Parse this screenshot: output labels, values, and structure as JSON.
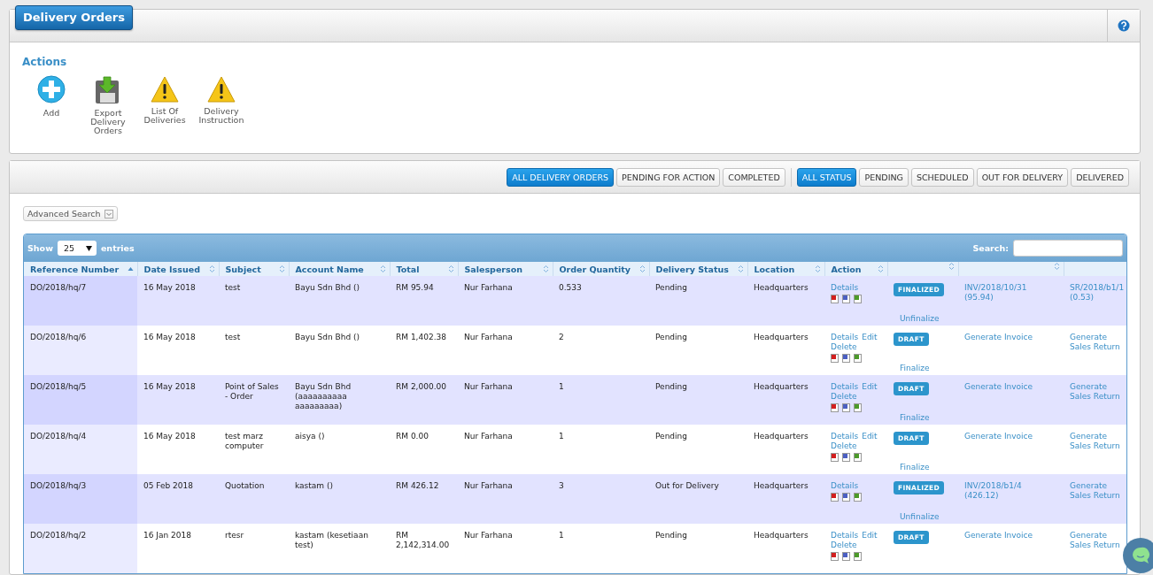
{
  "page_title": "Delivery Orders",
  "actions": {
    "heading": "Actions",
    "items": [
      {
        "kind": "add",
        "label": "Add"
      },
      {
        "kind": "export",
        "label": "Export Delivery Orders"
      },
      {
        "kind": "warning",
        "label": "List Of Deliveries"
      },
      {
        "kind": "warning",
        "label": "Delivery Instruction"
      }
    ]
  },
  "filter_groups": [
    [
      {
        "label": "ALL DELIVERY ORDERS",
        "selected": true
      },
      {
        "label": "PENDING FOR ACTION",
        "selected": false
      },
      {
        "label": "COMPLETED",
        "selected": false
      }
    ],
    [
      {
        "label": "ALL STATUS",
        "selected": true
      },
      {
        "label": "PENDING",
        "selected": false
      },
      {
        "label": "SCHEDULED",
        "selected": false
      },
      {
        "label": "OUT FOR DELIVERY",
        "selected": false
      },
      {
        "label": "DELIVERED",
        "selected": false
      }
    ]
  ],
  "advanced_search": "Advanced Search",
  "table": {
    "show_label": "Show",
    "page_size": "25",
    "entries_label": "entries",
    "search_label": "Search:",
    "columns": [
      {
        "label": "Reference Number",
        "sortable": true,
        "sorted_ascending": true
      },
      {
        "label": "Date Issued",
        "sortable": true,
        "sorted_ascending": false
      },
      {
        "label": "Subject",
        "sortable": true,
        "sorted_ascending": false
      },
      {
        "label": "Account Name",
        "sortable": true,
        "sorted_ascending": false
      },
      {
        "label": "Total",
        "sortable": true,
        "sorted_ascending": false
      },
      {
        "label": "Salesperson",
        "sortable": true,
        "sorted_ascending": false
      },
      {
        "label": "Order Quantity",
        "sortable": true,
        "sorted_ascending": false
      },
      {
        "label": "Delivery Status",
        "sortable": true,
        "sorted_ascending": false
      },
      {
        "label": "Location",
        "sortable": true,
        "sorted_ascending": false
      },
      {
        "label": "Action",
        "sortable": true,
        "sorted_ascending": false
      },
      {
        "sortable": true,
        "sorted_ascending": false
      },
      {
        "sortable": true,
        "sorted_ascending": false
      },
      {
        "sortable": false
      }
    ],
    "rows": [
      {
        "reference": "DO/2018/hq/7",
        "date": "16 May 2018",
        "subject": "test",
        "account": "Bayu Sdn Bhd ()",
        "total": "RM 95.94",
        "salesperson": "Nur Farhana",
        "quantity": "0.533",
        "delivery_status": "Pending",
        "location": "Headquarters",
        "actions": [
          "Details"
        ],
        "badge": {
          "label": "FINALIZED"
        },
        "toggle": "Unfinalize",
        "invoice": "INV/2018/10/31 (95.94)",
        "sales_return": "SR/2018/b1/1 (0.53)"
      },
      {
        "reference": "DO/2018/hq/6",
        "date": "16 May 2018",
        "subject": "test",
        "account": "Bayu Sdn Bhd ()",
        "total": "RM 1,402.38",
        "salesperson": "Nur Farhana",
        "quantity": "2",
        "delivery_status": "Pending",
        "location": "Headquarters",
        "actions": [
          "Details",
          "Edit",
          "Delete"
        ],
        "badge": {
          "label": "DRAFT"
        },
        "toggle": "Finalize",
        "invoice": "Generate Invoice",
        "sales_return": "Generate Sales Return"
      },
      {
        "reference": "DO/2018/hq/5",
        "date": "16 May 2018",
        "subject": "Point of Sales - Order",
        "account": "Bayu Sdn Bhd (aaaaaaaaaa aaaaaaaaa)",
        "total": "RM 2,000.00",
        "salesperson": "Nur Farhana",
        "quantity": "1",
        "delivery_status": "Pending",
        "location": "Headquarters",
        "actions": [
          "Details",
          "Edit",
          "Delete"
        ],
        "badge": {
          "label": "DRAFT"
        },
        "toggle": "Finalize",
        "invoice": "Generate Invoice",
        "sales_return": "Generate Sales Return"
      },
      {
        "reference": "DO/2018/hq/4",
        "date": "16 May 2018",
        "subject": "test marz computer",
        "account": "aisya ()",
        "total": "RM 0.00",
        "salesperson": "Nur Farhana",
        "quantity": "1",
        "delivery_status": "Pending",
        "location": "Headquarters",
        "actions": [
          "Details",
          "Edit",
          "Delete"
        ],
        "badge": {
          "label": "DRAFT"
        },
        "toggle": "Finalize",
        "invoice": "Generate Invoice",
        "sales_return": "Generate Sales Return"
      },
      {
        "reference": "DO/2018/hq/3",
        "date": "05 Feb 2018",
        "subject": "Quotation",
        "account": "kastam ()",
        "total": "RM 426.12",
        "salesperson": "Nur Farhana",
        "quantity": "3",
        "delivery_status": "Out for Delivery",
        "location": "Headquarters",
        "actions": [
          "Details"
        ],
        "badge": {
          "label": "FINALIZED"
        },
        "toggle": "Unfinalize",
        "invoice": "INV/2018/b1/4 (426.12)",
        "sales_return": "Generate Sales Return"
      },
      {
        "reference": "DO/2018/hq/2",
        "date": "16 Jan 2018",
        "subject": "rtesr",
        "account": "kastam (kesetiaan test)",
        "total": "RM 2,142,314.00",
        "salesperson": "Nur Farhana",
        "quantity": "1",
        "delivery_status": "Pending",
        "location": "Headquarters",
        "actions": [
          "Details",
          "Edit",
          "Delete"
        ],
        "badge": {
          "label": "DRAFT"
        },
        "invoice": "Generate Invoice",
        "sales_return": "Generate Sales Return"
      }
    ]
  }
}
